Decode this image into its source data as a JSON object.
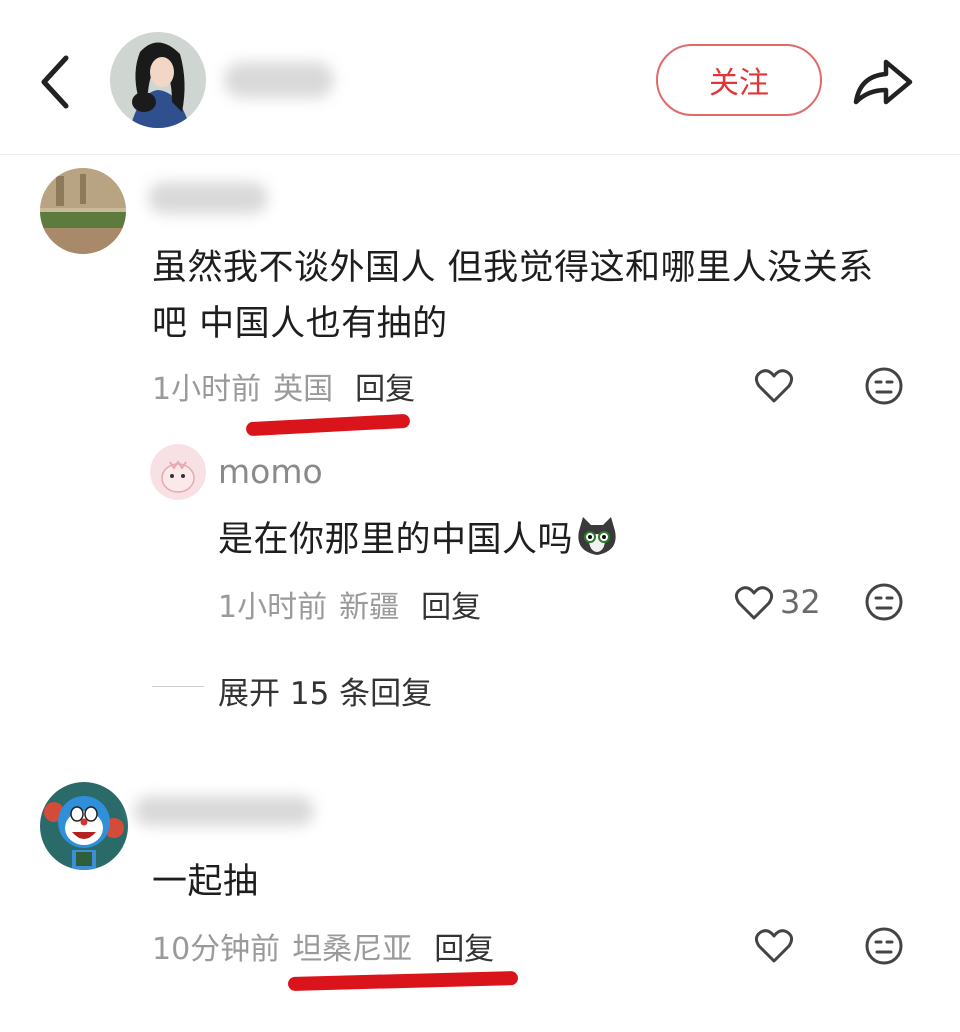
{
  "header": {
    "follow_label": "关注"
  },
  "comments": [
    {
      "text_line1": "虽然我不谈外国人 但我觉得这和哪里人没关系",
      "text_line2": "吧 中国人也有抽的",
      "time": "1小时前",
      "location": "英国",
      "reply_label": "回复",
      "replies": [
        {
          "username": "momo",
          "text": "是在你那里的中国人吗",
          "time": "1小时前",
          "location": "新疆",
          "reply_label": "回复",
          "likes": "32"
        }
      ],
      "expand_label": "展开 15 条回复"
    },
    {
      "text": "一起抽",
      "time": "10分钟前",
      "location": "坦桑尼亚",
      "reply_label": "回复"
    }
  ],
  "icons": [
    "back-arrow-icon",
    "share-arrow-icon",
    "heart-icon",
    "neutral-face-icon",
    "cat-emoji-icon"
  ],
  "colors": {
    "follow_accent": "#e0363a",
    "annotation_underline": "#d9151b",
    "muted_text": "#9a9a9a"
  }
}
